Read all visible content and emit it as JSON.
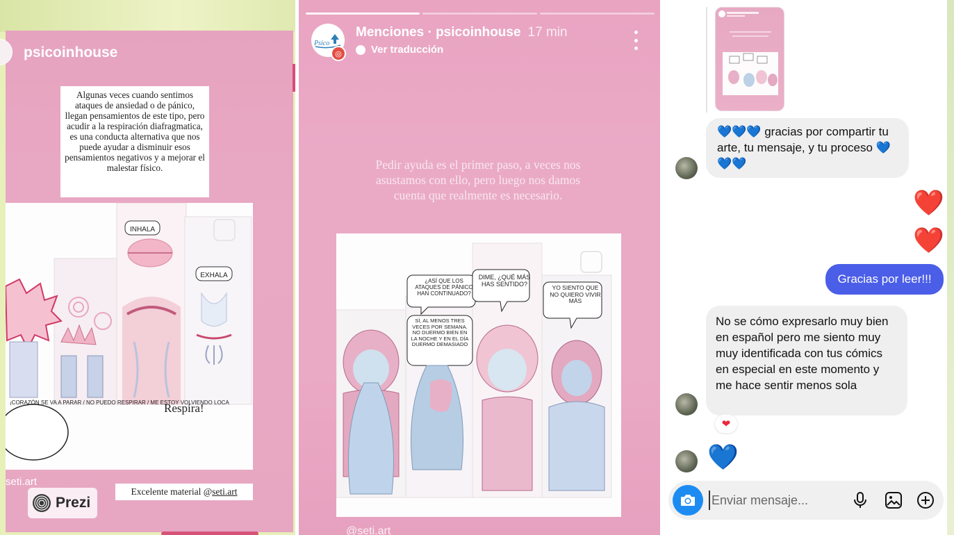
{
  "left_story": {
    "username": "psicoinhouse",
    "note": "Algunas veces cuando sentimos ataques de ansiedad o de pánico, llegan pensamientos de este tipo, pero acudir a la respiración diafragmatica, es una conducta alternativa que nos puede ayudar a disminuir esos pensamientos negativos y a mejorar el malestar físico.",
    "comic_inhala": "INHALA",
    "comic_exhala": "EXHALA",
    "comic_chaos": "¡CORAZÓN SE VA A PARAR / NO PUEDO RESPIRAR / ME ESTOY VOLVIENDO LOCA",
    "respira": "Respira!",
    "credit": "seti.art",
    "excelente_prefix": "Excelente material @",
    "excelente_handle": "seti.art",
    "prezi_label": "Prezi"
  },
  "middle_story": {
    "title": "Menciones · psicoinhouse",
    "time": "17 min",
    "translation": "Ver traducción",
    "quote": "Pedir ayuda es el primer paso, a veces nos asustamos con ello, pero luego nos damos cuenta que realmente es necesario.",
    "bubble1": "¿ASÍ QUE LOS ATAQUES DE PÁNICO HAN CONTINUADO?",
    "bubble2": "SÍ, AL MENOS TRES VECES POR SEMANA. NO DUERMO BIEN EN LA NOCHE Y EN EL DÍA DUERMO DEMASIADO",
    "bubble3": "DIME, ¿QUÉ MÁS HAS SENTIDO?",
    "bubble4": "YO SIENTO QUE NO QUIERO VIVIR MÁS",
    "credit": "@seti.art"
  },
  "dm": {
    "msg1": "💙💙💙 gracias por compartir tu arte, tu mensaje, y tu proceso 💙💙💙",
    "heart": "❤️",
    "msg_out": "Gracias por leer!!!",
    "msg2": "No se cómo expresarlo muy bien en español pero me siento muy muy identificada con tus cómics en especial en este momento y me hace sentir menos sola",
    "reaction": "❤",
    "blue_heart": "💙",
    "composer_placeholder": "Enviar mensaje..."
  },
  "colors": {
    "story_pink": "#e9a8c3",
    "dm_blue": "#4b5ee8",
    "camera_blue": "#1d8cf2",
    "accent_red": "#d94c77"
  }
}
